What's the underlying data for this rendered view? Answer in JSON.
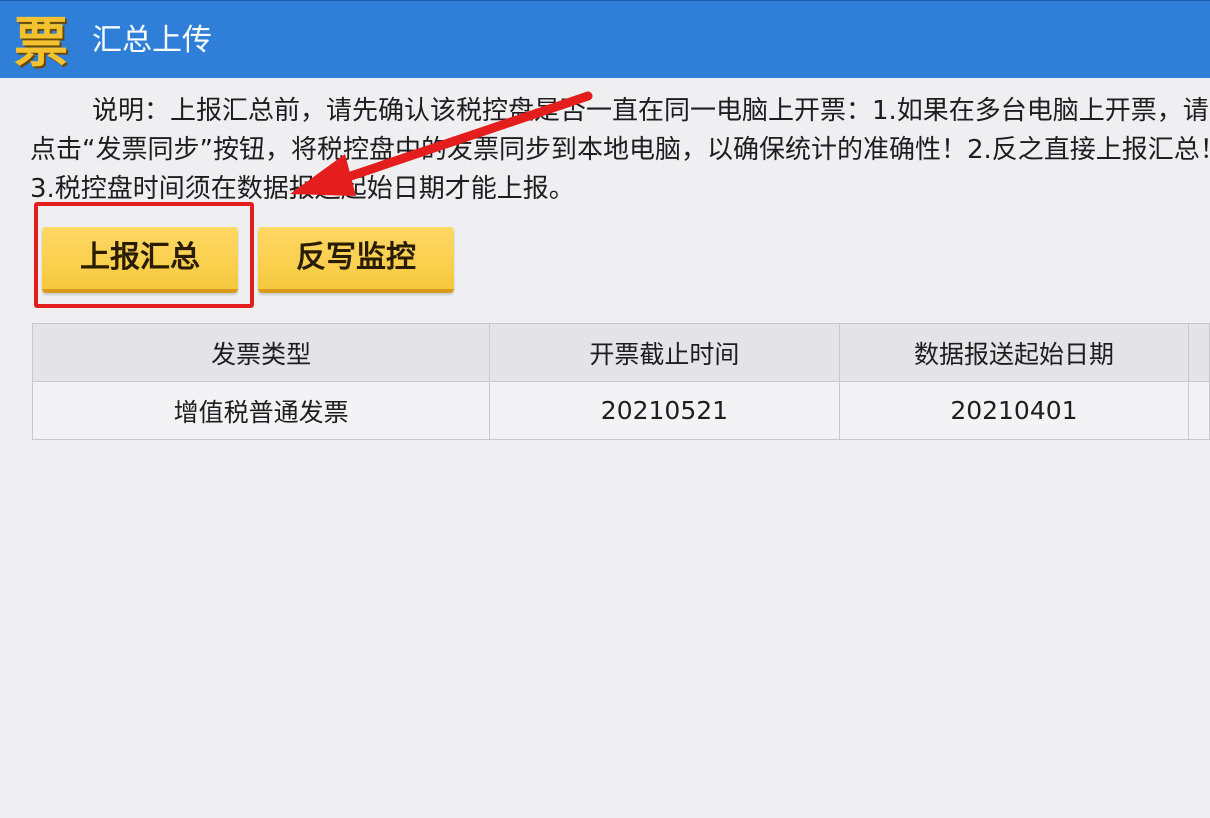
{
  "window": {
    "logo_char": "票",
    "title": "汇总上传"
  },
  "description": "说明：上报汇总前，请先确认该税控盘是否一直在同一电脑上开票：1.如果在多台电脑上开票，请先点击“发票同步”按钮，将税控盘中的发票同步到本地电脑，以确保统计的准确性！2.反之直接上报汇总！3.税控盘时间须在数据报送起始日期才能上报。",
  "buttons": {
    "upload_summary": "上报汇总",
    "write_back_monitor": "反写监控"
  },
  "table": {
    "headers": [
      "发票类型",
      "开票截止时间",
      "数据报送起始日期",
      ""
    ],
    "rows": [
      [
        "增值税普通发票",
        "20210521",
        "20210401",
        ""
      ]
    ]
  },
  "annotation": {
    "color": "#e41d1d"
  }
}
